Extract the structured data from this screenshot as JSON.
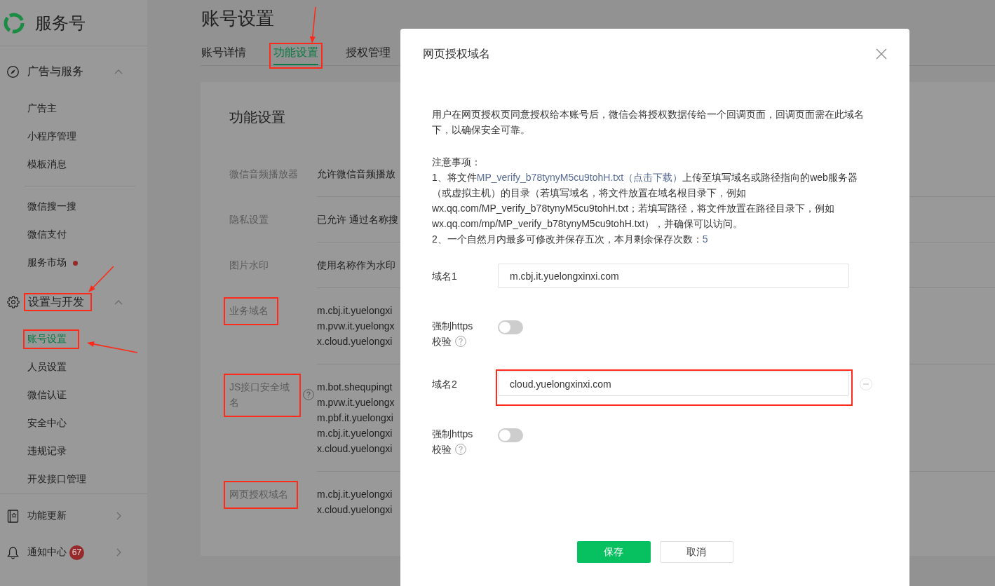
{
  "sidebar": {
    "brand": "服务号",
    "menus": [
      {
        "groups": [
          {
            "title": "广告与服务",
            "expanded": true,
            "highlighted": false,
            "arrow": false,
            "sections": [
              {
                "items": [
                  {
                    "label": "广告主",
                    "selected": false,
                    "dot": false,
                    "highlighted": false,
                    "arrow": false
                  },
                  {
                    "label": "小程序管理",
                    "selected": false,
                    "dot": false,
                    "highlighted": false,
                    "arrow": false
                  },
                  {
                    "label": "模板消息",
                    "selected": false,
                    "dot": false,
                    "highlighted": false,
                    "arrow": false
                  }
                ]
              },
              {
                "items": [
                  {
                    "label": "微信搜一搜",
                    "selected": false,
                    "dot": false,
                    "highlighted": false,
                    "arrow": false
                  },
                  {
                    "label": "微信支付",
                    "selected": false,
                    "dot": false,
                    "highlighted": false,
                    "arrow": false
                  },
                  {
                    "label": "服务市场",
                    "selected": false,
                    "dot": true,
                    "highlighted": false,
                    "arrow": false
                  }
                ]
              }
            ]
          },
          {
            "title": "设置与开发",
            "expanded": true,
            "highlighted": true,
            "arrow": true,
            "sections": [
              {
                "items": [
                  {
                    "label": "账号设置",
                    "selected": true,
                    "dot": false,
                    "highlighted": true,
                    "arrow": true
                  },
                  {
                    "label": "人员设置",
                    "selected": false,
                    "dot": false,
                    "highlighted": false,
                    "arrow": false
                  },
                  {
                    "label": "微信认证",
                    "selected": false,
                    "dot": false,
                    "highlighted": false,
                    "arrow": false
                  },
                  {
                    "label": "安全中心",
                    "selected": false,
                    "dot": false,
                    "highlighted": false,
                    "arrow": false
                  },
                  {
                    "label": "违规记录",
                    "selected": false,
                    "dot": false,
                    "highlighted": false,
                    "arrow": false
                  },
                  {
                    "label": "开发接口管理",
                    "selected": false,
                    "dot": false,
                    "highlighted": false,
                    "arrow": false
                  }
                ]
              }
            ]
          }
        ]
      },
      {
        "groups": [
          {
            "title": "功能更新",
            "expanded": false,
            "highlighted": false,
            "arrow": false
          },
          {
            "title": "通知中心",
            "expanded": false,
            "highlighted": false,
            "arrow": false,
            "badge": "67"
          }
        ]
      }
    ]
  },
  "page": {
    "title": "账号设置",
    "tabs": [
      {
        "label": "账号详情",
        "selected": false,
        "highlighted": false,
        "arrow": false
      },
      {
        "label": "功能设置",
        "selected": true,
        "highlighted": true,
        "arrow": true
      },
      {
        "label": "授权管理",
        "selected": false,
        "highlighted": false,
        "arrow": false
      }
    ]
  },
  "card": {
    "title": "功能设置",
    "rows": [
      {
        "label": "微信音频播放器",
        "help": false,
        "highlighted": false,
        "values": [
          "允许微信音频播放"
        ]
      },
      {
        "label": "隐私设置",
        "help": false,
        "highlighted": false,
        "values": [
          "已允许 通过名称搜"
        ]
      },
      {
        "label": "图片水印",
        "help": false,
        "highlighted": false,
        "values": [
          "使用名称作为水印"
        ]
      },
      {
        "label": "业务域名",
        "help": false,
        "highlighted": true,
        "values": [
          "m.cbj.it.yuelongxi",
          "m.pvw.it.yuelongx",
          "x.cloud.yuelongxi"
        ]
      },
      {
        "label": "JS接口安全域名",
        "help": true,
        "highlighted": true,
        "values": [
          "m.bot.shequpingt",
          "m.pvw.it.yuelongx",
          "m.pbf.it.yuelongxi",
          "m.cbj.it.yuelongxi",
          "x.cloud.yuelongxi"
        ]
      },
      {
        "label": "网页授权域名",
        "help": false,
        "highlighted": true,
        "values": [
          "m.cbj.it.yuelongxi",
          "x.cloud.yuelongxi"
        ]
      }
    ]
  },
  "modal": {
    "title": "网页授权域名",
    "description": "用户在网页授权页同意授权给本账号后，微信会将授权数据传给一个回调页面，回调页面需在此域名下，以确保安全可靠。",
    "notes": {
      "heading": "注意事项：",
      "items": [
        {
          "before": "1、将文件",
          "link": "MP_verify_b78tynyM5cu9tohH.txt（点击下载）",
          "after": "上传至填写域名或路径指向的web服务器（或虚拟主机）的目录（若填写域名，将文件放置在域名根目录下，例如wx.qq.com/MP_verify_b78tynyM5cu9tohH.txt；若填写路径，将文件放置在路径目录下，例如wx.qq.com/mp/MP_verify_b78tynyM5cu9tohH.txt），并确保可以访问。"
        },
        {
          "before": "2、一个自然月内最多可修改并保存五次，本月剩余保存次数：",
          "count": "5"
        }
      ]
    },
    "form": [
      {
        "kind": "domain",
        "label": "域名1",
        "value": "m.cbj.it.yuelongxinxi.com",
        "removable": false,
        "highlighted": false
      },
      {
        "kind": "toggle",
        "label": "强制https校验",
        "help": true,
        "on": false
      },
      {
        "kind": "domain",
        "label": "域名2",
        "value": "cloud.yuelongxinxi.com",
        "removable": true,
        "highlighted": true
      },
      {
        "kind": "toggle",
        "label": "强制https校验",
        "help": true,
        "on": false
      }
    ],
    "buttons": [
      {
        "label": "保存",
        "kind": "primary"
      },
      {
        "label": "取消",
        "kind": "default"
      }
    ]
  }
}
